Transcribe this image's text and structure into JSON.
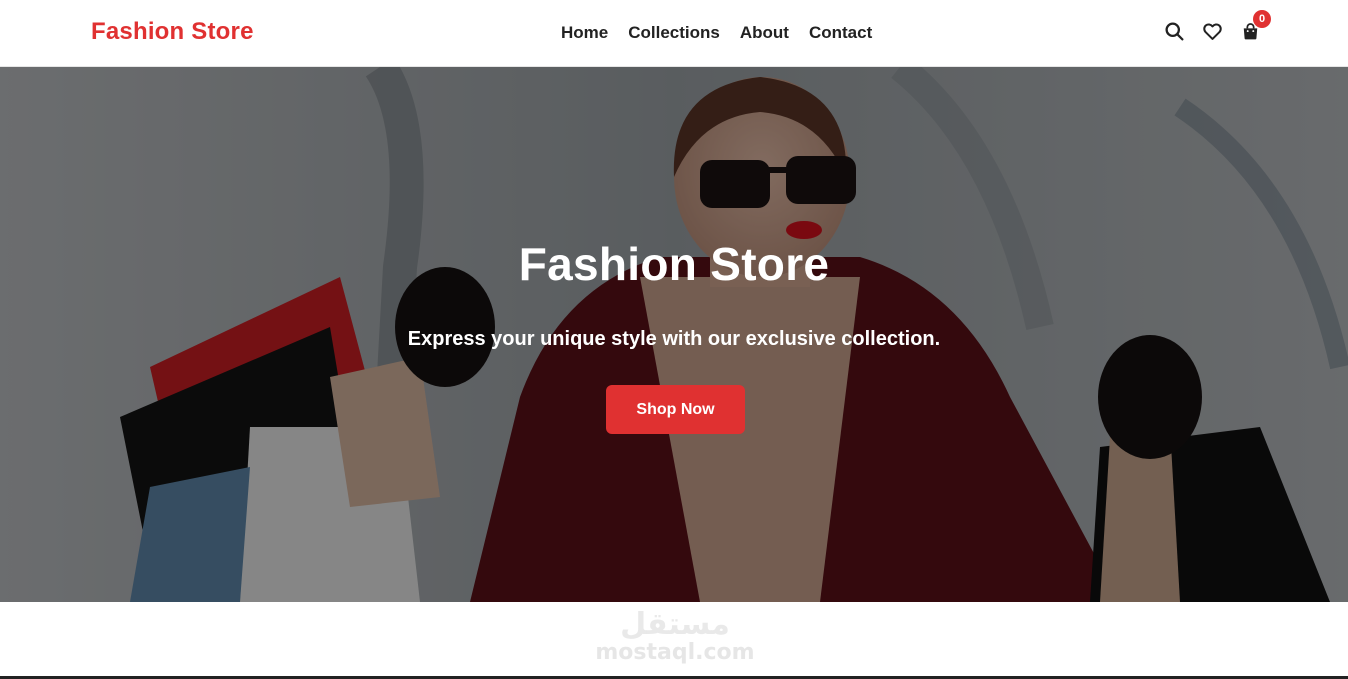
{
  "navbar": {
    "brand": "Fashion Store",
    "links": [
      {
        "label": "Home"
      },
      {
        "label": "Collections"
      },
      {
        "label": "About"
      },
      {
        "label": "Contact"
      }
    ],
    "icons": {
      "search": "search-icon",
      "wishlist": "heart-icon",
      "cart": "shopping-bag-icon"
    },
    "cart_count": "0"
  },
  "hero": {
    "title": "Fashion Store",
    "subtitle": "Express your unique style with our exclusive collection.",
    "cta_label": "Shop Now"
  },
  "watermark": {
    "arabic": "مستقل",
    "latin": "mostaql.com"
  },
  "colors": {
    "accent": "#e03131",
    "text": "#222222",
    "background": "#ffffff"
  }
}
